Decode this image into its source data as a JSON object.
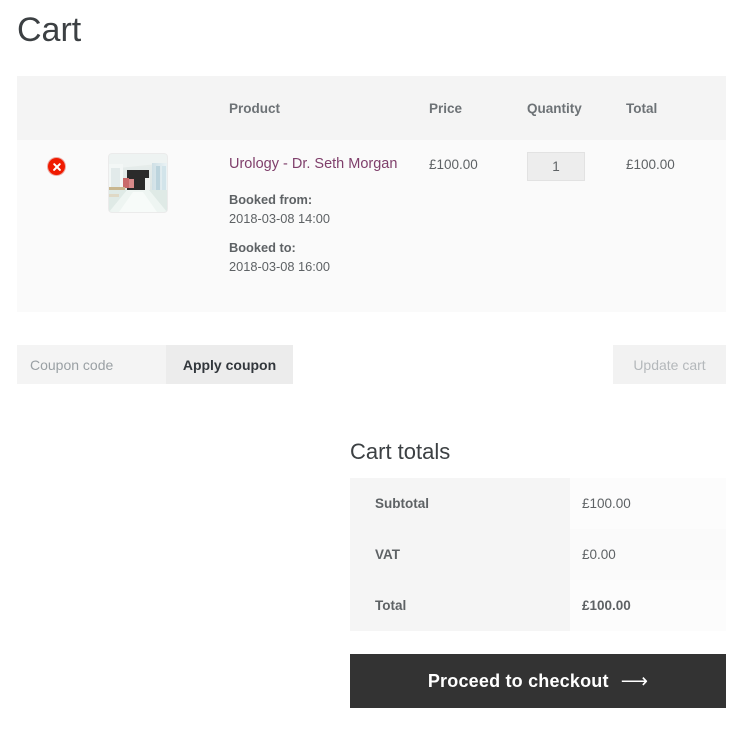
{
  "page": {
    "title": "Cart"
  },
  "cart_table": {
    "headers": {
      "remove": "",
      "thumbnail": "",
      "product": "Product",
      "price": "Price",
      "quantity": "Quantity",
      "total": "Total"
    },
    "rows": [
      {
        "remove_icon": "remove-circle-icon",
        "thumbnail_alt": "hospital-corridor-photo",
        "product_name": "Urology - Dr. Seth Morgan",
        "booked_from_label": "Booked from:",
        "booked_from_value": "2018-03-08 14:00",
        "booked_to_label": "Booked to:",
        "booked_to_value": "2018-03-08 16:00",
        "price": "£100.00",
        "quantity": "1",
        "total": "£100.00"
      }
    ]
  },
  "coupon": {
    "placeholder": "Coupon code",
    "value": "",
    "apply_label": "Apply coupon",
    "update_label": "Update cart"
  },
  "totals": {
    "heading": "Cart totals",
    "rows": [
      {
        "label": "Subtotal",
        "value": "£100.00"
      },
      {
        "label": "VAT",
        "value": "£0.00"
      },
      {
        "label": "Total",
        "value": "£100.00"
      }
    ],
    "checkout_label": "Proceed to checkout",
    "checkout_arrow": "⟶"
  },
  "colors": {
    "remove_red": "#f01a00",
    "product_link": "#7f3f6b",
    "checkout_bg": "#333333",
    "header_bg": "#f4f4f4",
    "row_bg": "#fafafa"
  }
}
